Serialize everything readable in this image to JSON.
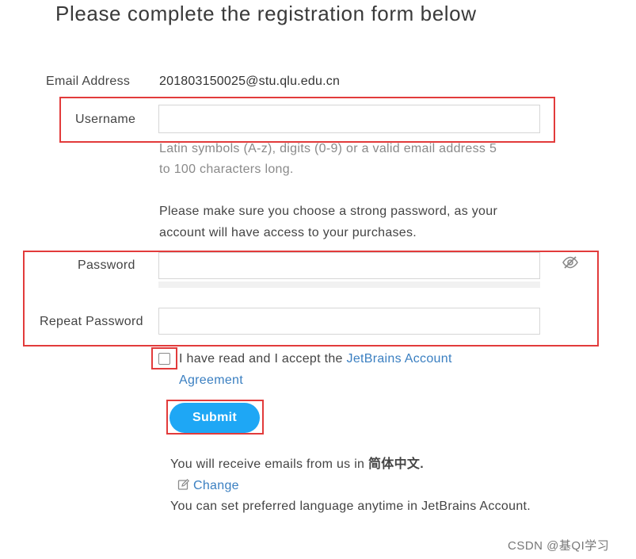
{
  "page": {
    "title": "Please complete the registration form below"
  },
  "form": {
    "email": {
      "label": "Email Address",
      "value": "201803150025@stu.qlu.edu.cn"
    },
    "username": {
      "label": "Username",
      "value": "",
      "hint": "Latin symbols (A-z), digits (0-9) or a valid email address 5 to 100 characters long."
    },
    "password_note": "Please make sure you choose a strong password, as your account will have access to your purchases.",
    "password": {
      "label": "Password",
      "value": "",
      "toggle_icon": "eye-slash-icon"
    },
    "repeat_password": {
      "label": "Repeat Password",
      "value": ""
    },
    "agreement": {
      "checked": false,
      "prefix": "I have read and I accept the ",
      "link_text": "JetBrains Account Agreement"
    },
    "submit_label": "Submit"
  },
  "footer": {
    "emails_prefix": "You will receive emails from us in ",
    "language": "简体中文.",
    "change_icon": "edit-icon",
    "change_label": "Change",
    "note": "You can set preferred language anytime in JetBrains Account."
  },
  "watermark": "CSDN @基QI学习",
  "colors": {
    "accent": "#1ea7f5",
    "link": "#3a7fc1",
    "highlight": "#e23b3b"
  }
}
